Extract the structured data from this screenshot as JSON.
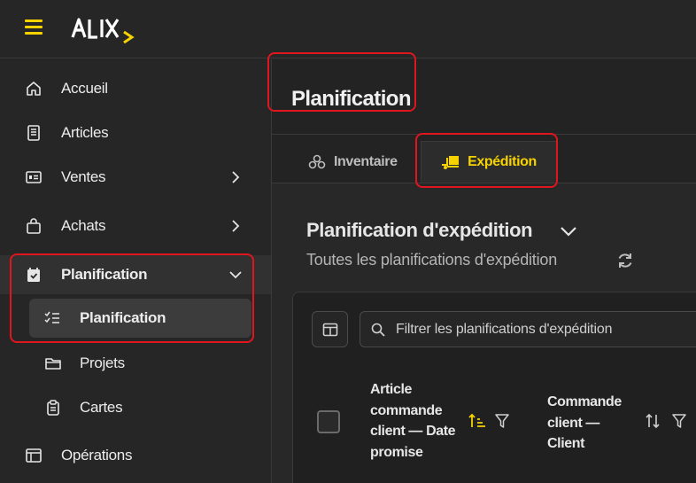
{
  "brand": {
    "accent": "#f5d200",
    "highlight": "#e0161e",
    "logo_text": "ALIX"
  },
  "sidebar": {
    "items": [
      {
        "label": "Accueil",
        "icon": "home-icon"
      },
      {
        "label": "Articles",
        "icon": "book-icon"
      },
      {
        "label": "Ventes",
        "icon": "id-card-icon"
      },
      {
        "label": "Achats",
        "icon": "shopping-bag-icon"
      },
      {
        "label": "Planification",
        "icon": "calendar-check-icon"
      },
      {
        "label": "Planification",
        "icon": "checklist-icon"
      },
      {
        "label": "Projets",
        "icon": "folder-icon"
      },
      {
        "label": "Cartes",
        "icon": "clipboard-icon"
      },
      {
        "label": "Opérations",
        "icon": "layout-icon"
      }
    ]
  },
  "page": {
    "title": "Planification",
    "tabs": [
      {
        "label": "Inventaire",
        "icon": "boxes-icon"
      },
      {
        "label": "Expédition",
        "icon": "truck-loading-icon"
      }
    ]
  },
  "section": {
    "title": "Planification d'expédition",
    "subtitle": "Toutes les planifications d'expédition"
  },
  "table": {
    "filter_placeholder": "Filtrer les planifications d'expédition",
    "columns": [
      {
        "label": "Article commande client — Date promise"
      },
      {
        "label": "Commande client — Client"
      }
    ]
  }
}
